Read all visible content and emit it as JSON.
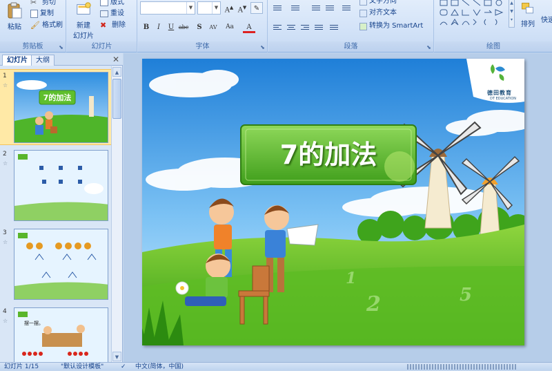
{
  "ribbon": {
    "clipboard": {
      "paste": "粘贴",
      "cut": "剪切",
      "copy": "复制",
      "format_painter": "格式刷",
      "label": "剪贴板"
    },
    "slides": {
      "new_slide": "新建",
      "new_slide_2": "幻灯片",
      "layout": "版式",
      "reset": "重设",
      "delete": "删除",
      "label": "幻灯片"
    },
    "font": {
      "label": "字体"
    },
    "paragraph": {
      "text_direction": "文字方向",
      "align_text": "对齐文本",
      "smartart": "转换为 SmartArt",
      "label": "段落"
    },
    "drawing": {
      "arrange": "排列",
      "quick_styles": "快速",
      "label": "绘图"
    }
  },
  "panel": {
    "tab_slides": "幻灯片",
    "tab_outline": "大纲",
    "close": "✕",
    "thumbnails": [
      {
        "num": "1",
        "star": "☆",
        "title": "7的加法"
      },
      {
        "num": "2",
        "star": "☆"
      },
      {
        "num": "3",
        "star": "☆"
      },
      {
        "num": "4",
        "star": "☆",
        "caption": "摆一摆。"
      }
    ]
  },
  "slide": {
    "title": "7的加法",
    "logo_cn": "德田教育",
    "logo_en": "DT EDUCATION",
    "digits": [
      "1",
      "2",
      "5"
    ]
  },
  "status": {
    "slide_count": "幻灯片 1/15",
    "theme": "\"默认设计模板\"",
    "language": "中文(简体，中国)"
  },
  "colors": {
    "ribbon_bg": "#d3e3f8",
    "title_green": "#59b52a",
    "sky_blue": "#4a9be0",
    "grass_green": "#3fa41c",
    "selection": "#ffe9a6"
  }
}
